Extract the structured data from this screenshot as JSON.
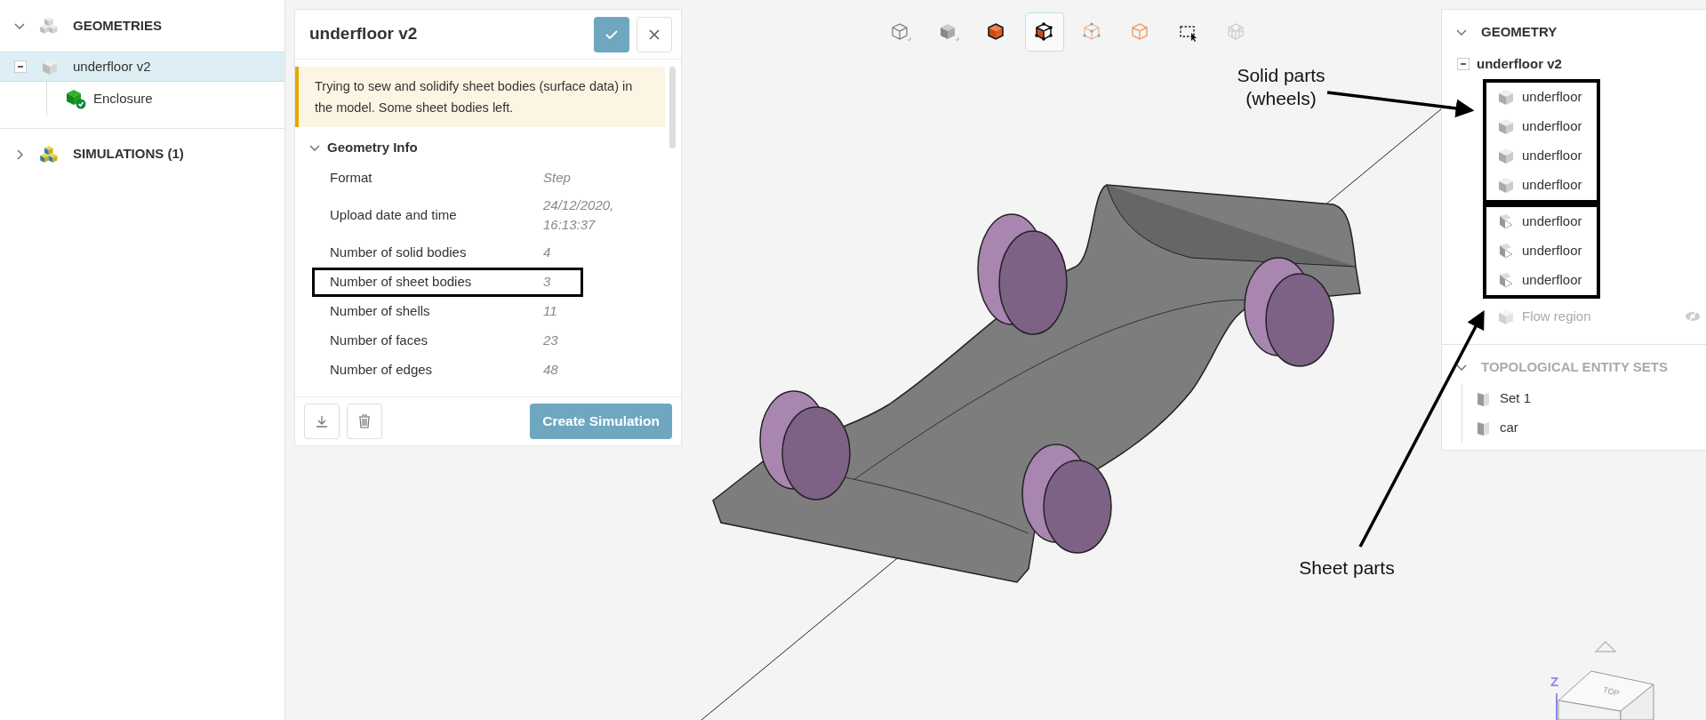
{
  "sidebar": {
    "sections": [
      {
        "kind": "geometries",
        "title": "GEOMETRIES",
        "expanded": true,
        "children": [
          {
            "label": "underfloor v2",
            "selected": true,
            "expanded": true,
            "children": [
              {
                "label": "Enclosure",
                "selected": false,
                "verified": true
              }
            ]
          }
        ]
      },
      {
        "kind": "simulations",
        "title": "SIMULATIONS (1)",
        "expanded": false
      }
    ]
  },
  "panel": {
    "title": "underfloor v2",
    "warning": "Trying to sew and solidify sheet bodies (surface data) in the model. Some sheet bodies left.",
    "section": {
      "title": "Geometry Info",
      "expanded": true,
      "rows": [
        {
          "label": "Format",
          "value": "Step",
          "highlighted": false
        },
        {
          "label": "Upload date and time",
          "value": "24/12/2020, 16:13:37",
          "highlighted": false
        },
        {
          "label": "Number of solid bodies",
          "value": "4",
          "highlighted": false
        },
        {
          "label": "Number of sheet bodies",
          "value": "3",
          "highlighted": true
        },
        {
          "label": "Number of shells",
          "value": "11",
          "highlighted": false
        },
        {
          "label": "Number of faces",
          "value": "23",
          "highlighted": false
        },
        {
          "label": "Number of edges",
          "value": "48",
          "highlighted": false
        }
      ]
    },
    "primary_button": "Create Simulation"
  },
  "toolbar": [
    {
      "kind": "wire",
      "selected": false
    },
    {
      "kind": "shaded",
      "selected": false
    },
    {
      "kind": "orange-solid",
      "selected": false
    },
    {
      "kind": "split-solid",
      "selected": true
    },
    {
      "kind": "dotted-wire",
      "selected": false
    },
    {
      "kind": "orange-outline",
      "selected": false
    },
    {
      "kind": "box-select",
      "selected": false
    },
    {
      "kind": "grid",
      "selected": false
    }
  ],
  "geometry_panel": {
    "title": "GEOMETRY",
    "expanded": true,
    "tree": {
      "label": "underfloor v2",
      "expanded": true,
      "groups": [
        {
          "kind": "solid",
          "boxed": true,
          "items": [
            {
              "label": "underfloor",
              "disabled": false,
              "hidden": false
            },
            {
              "label": "underfloor",
              "disabled": false,
              "hidden": false
            },
            {
              "label": "underfloor",
              "disabled": false,
              "hidden": false
            },
            {
              "label": "underfloor",
              "disabled": false,
              "hidden": false
            }
          ]
        },
        {
          "kind": "sheet",
          "boxed": true,
          "items": [
            {
              "label": "underfloor",
              "disabled": false,
              "hidden": false
            },
            {
              "label": "underfloor",
              "disabled": false,
              "hidden": false
            },
            {
              "label": "underfloor",
              "disabled": false,
              "hidden": false
            }
          ]
        },
        {
          "kind": "solid",
          "boxed": false,
          "items": [
            {
              "label": "Flow region",
              "disabled": true,
              "hidden": true
            }
          ]
        }
      ]
    },
    "sets": {
      "title": "TOPOLOGICAL ENTITY SETS",
      "disabled": true,
      "expanded": true,
      "items": [
        {
          "label": "Set 1"
        },
        {
          "label": "car"
        }
      ]
    }
  },
  "annotations": [
    {
      "kind": "solid",
      "text": "Solid parts (wheels)"
    },
    {
      "kind": "sheet",
      "text": "Sheet parts"
    }
  ],
  "view_cube": {
    "face_label": "TOP",
    "axis_label": "Z"
  }
}
